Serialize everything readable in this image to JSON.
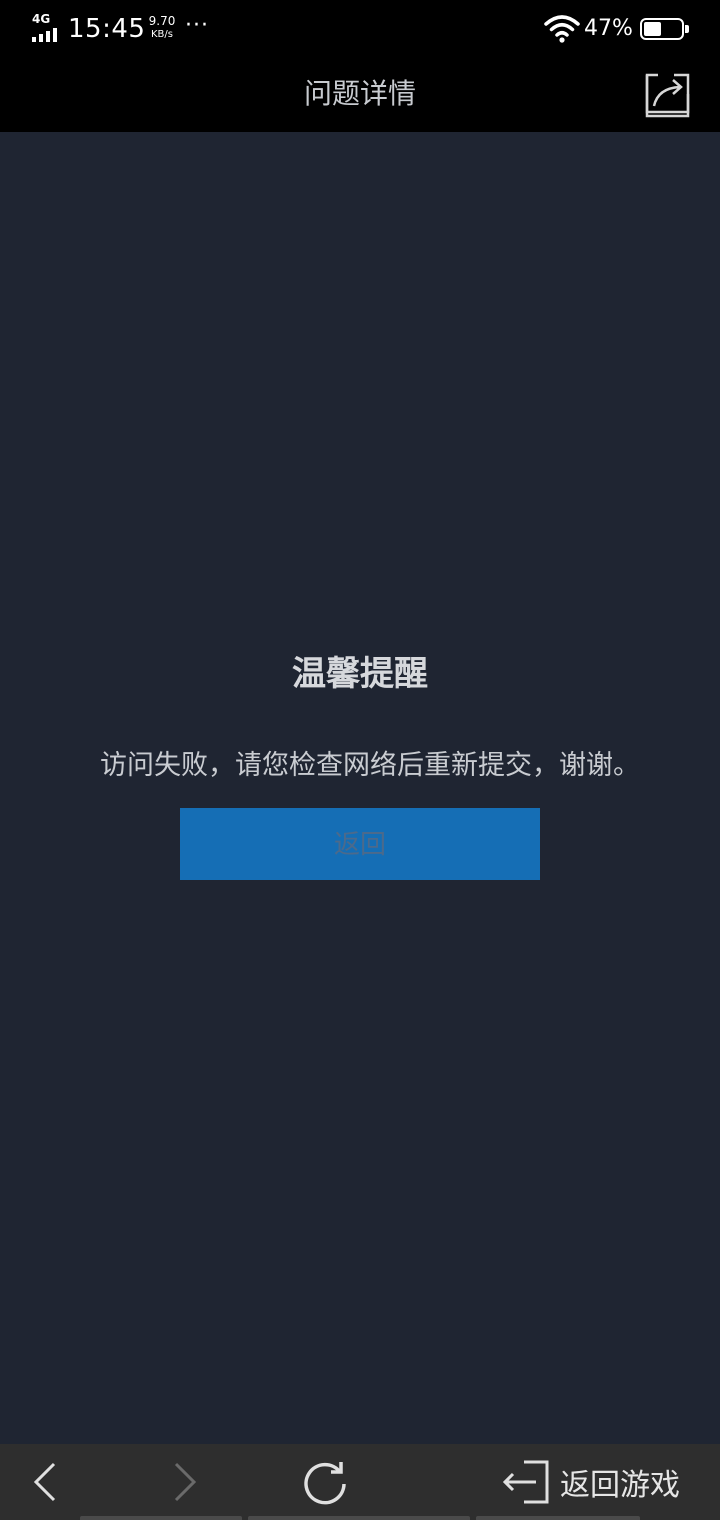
{
  "status_bar": {
    "network_type": "4G",
    "time": "15:45",
    "speed_value": "9.70",
    "speed_unit": "KB/s",
    "more": "···",
    "battery_percent": "47%",
    "battery_level": 0.47
  },
  "header": {
    "title": "问题详情",
    "share_icon": "share-icon"
  },
  "notice": {
    "title": "温馨提醒",
    "message": "访问失败，请您检查网络后重新提交，谢谢。",
    "back_button_label": "返回"
  },
  "bottom_nav": {
    "back_icon": "chevron-left-icon",
    "forward_icon": "chevron-right-icon",
    "refresh_icon": "refresh-icon",
    "return_game_icon": "exit-icon",
    "return_game_label": "返回游戏"
  },
  "colors": {
    "background": "#1f2532",
    "bar_background": "#000000",
    "button_blue": "#156eb5",
    "nav_background": "#2e2e2e"
  }
}
